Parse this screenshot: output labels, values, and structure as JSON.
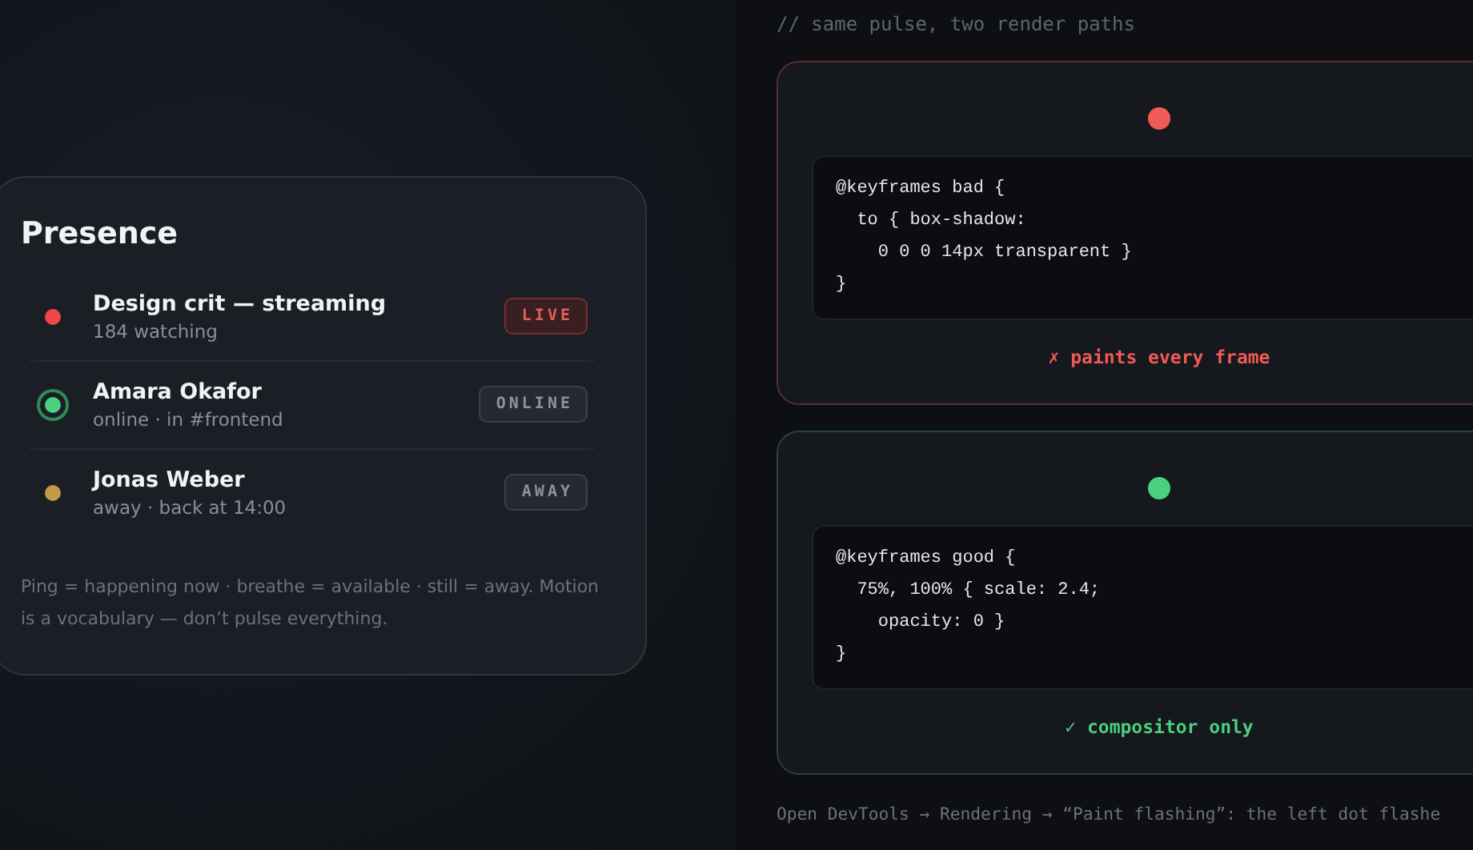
{
  "presence": {
    "title": "Presence",
    "items": [
      {
        "kind": "live",
        "name": "Design crit — streaming",
        "detail": "184 watching",
        "badge": "LIVE",
        "color": "#f04848"
      },
      {
        "kind": "online",
        "name": "Amara Okafor",
        "detail": "online · in #frontend",
        "badge": "ONLINE",
        "color": "#4ad07e"
      },
      {
        "kind": "away",
        "name": "Jonas Weber",
        "detail": "away · back at 14:00",
        "badge": "AWAY",
        "color": "#c49a45"
      }
    ],
    "note": "Ping = happening now · breathe = available · still = away. Motion is a vocabulary — don’t pulse everything."
  },
  "demo": {
    "comment": "// same pulse, two render paths",
    "cards": [
      {
        "kind": "bad",
        "color": "#f25a55",
        "code": [
          "@keyframes bad {",
          "  to { box-shadow:",
          "    0 0 0 14px transparent }",
          "}"
        ],
        "verdict": "✗ paints every frame"
      },
      {
        "kind": "good",
        "color": "#4ad07e",
        "code": [
          "@keyframes good {",
          "  75%, 100% { scale: 2.4;",
          "    opacity: 0 }",
          "}"
        ],
        "verdict": "✓ compositor only"
      }
    ],
    "paragraph": [
      "Open DevTools → Rendering → “Paint flashing”: the left dot flashe"
    ]
  }
}
